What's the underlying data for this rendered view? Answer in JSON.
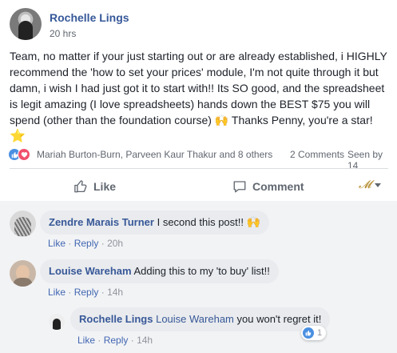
{
  "post": {
    "author": "Rochelle Lings",
    "time": "20 hrs",
    "body": "Team, no matter if your just starting out or are already established, i HIGHLY recommend the 'how to set your prices' module, I'm not quite through it but damn, i wish I had just got it to start with!! Its SO good, and the spreadsheet is legit amazing (I love spreadsheets) hands down the BEST $75 you will spend (other than the foundation course)",
    "body_end": "Thanks Penny, you're a star!"
  },
  "reactions": {
    "names": "Mariah Burton-Burn, Parveen Kaur Thakur and 8 others",
    "comments": "2 Comments",
    "seen": "Seen by 14"
  },
  "actions": {
    "like": "Like",
    "comment": "Comment"
  },
  "comments": [
    {
      "author": "Zendre Marais Turner",
      "text": "I second this post!!",
      "like": "Like",
      "reply": "Reply",
      "time": "20h"
    },
    {
      "author": "Louise Wareham",
      "text": "Adding this to my 'to buy' list!!",
      "like": "Like",
      "reply": "Reply",
      "time": "14h"
    }
  ],
  "reply": {
    "author": "Rochelle Lings",
    "mention": "Louise Wareham",
    "text": "you won't regret it!",
    "like": "Like",
    "reply": "Reply",
    "time": "14h",
    "reaction_count": "1"
  },
  "colors": {
    "link_blue": "#365899",
    "like_blue": "#4a90e2",
    "love_red": "#f0506e",
    "comment_bg": "#f2f3f5",
    "bubble_bg": "#e9ebee"
  },
  "icons": {
    "like": "thumbs-up-icon",
    "comment": "speech-bubble-icon",
    "praise": "raised-hands-emoji",
    "star": "star-emoji"
  }
}
